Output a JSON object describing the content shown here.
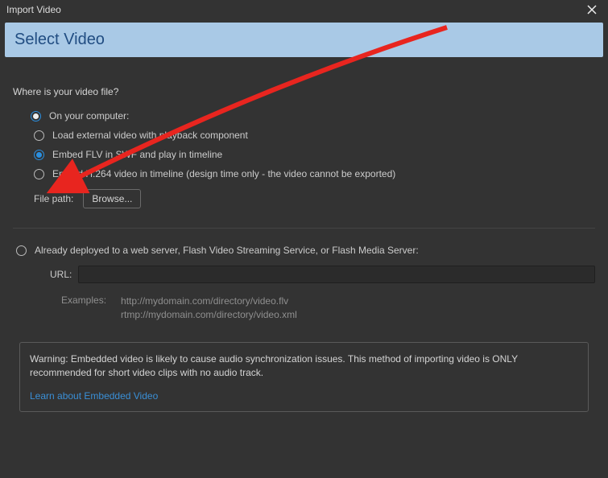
{
  "titlebar": {
    "title": "Import Video"
  },
  "header": {
    "title": "Select Video"
  },
  "question": "Where is your video file?",
  "computer": {
    "label": "On your computer:",
    "options": {
      "load_external": "Load external video with playback component",
      "embed_flv": "Embed FLV in SWF and play in timeline",
      "embed_h264": "Embed H.264 video in timeline (design time only - the video cannot be exported)"
    },
    "file_path_label": "File path:",
    "browse_label": "Browse..."
  },
  "deployed": {
    "label": "Already deployed to a web server, Flash Video Streaming Service, or Flash Media Server:",
    "url_label": "URL:",
    "examples_label": "Examples:",
    "example1": "http://mydomain.com/directory/video.flv",
    "example2": "rtmp://mydomain.com/directory/video.xml"
  },
  "warning_box": {
    "text": "Warning: Embedded video is likely to cause audio synchronization issues. This method of importing video is ONLY recommended for short video clips with no audio track.",
    "link": "Learn about Embedded Video"
  }
}
